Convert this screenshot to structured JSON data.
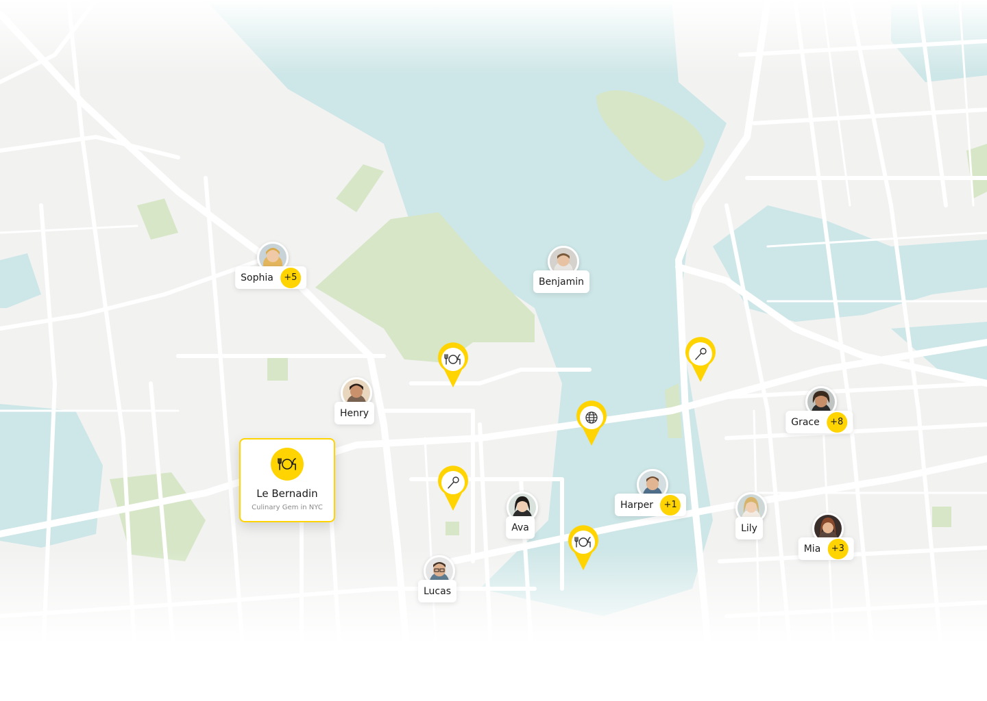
{
  "map": {
    "colors": {
      "land": "#F2F2F1",
      "water": "#CDE6E7",
      "park": "#D6E6C6",
      "road": "#FFFFFF",
      "accent": "#FFD400"
    }
  },
  "people": [
    {
      "name": "Sophia",
      "badge": "+5"
    },
    {
      "name": "Benjamin",
      "badge": ""
    },
    {
      "name": "Henry",
      "badge": ""
    },
    {
      "name": "Grace",
      "badge": "+8"
    },
    {
      "name": "Harper",
      "badge": "+1"
    },
    {
      "name": "Ava",
      "badge": ""
    },
    {
      "name": "Lily",
      "badge": ""
    },
    {
      "name": "Mia",
      "badge": "+3"
    },
    {
      "name": "Lucas",
      "badge": ""
    }
  ],
  "pins": [
    {
      "icon": "restaurant-icon"
    },
    {
      "icon": "microphone-icon"
    },
    {
      "icon": "globe-icon"
    },
    {
      "icon": "microphone-icon"
    },
    {
      "icon": "restaurant-icon"
    }
  ],
  "selected_place": {
    "title": "Le Bernadin",
    "subtitle": "Culinary Gem in NYC",
    "icon": "restaurant-icon"
  }
}
